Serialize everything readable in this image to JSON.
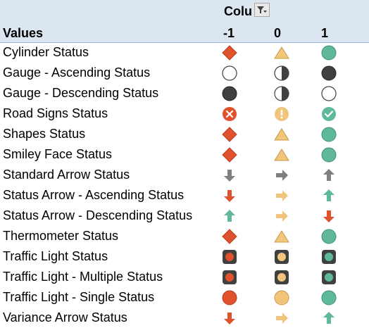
{
  "pivot": {
    "column_header": "Columns",
    "values_label": "Values",
    "columns": [
      "-1",
      "0",
      "1"
    ]
  },
  "rows": [
    {
      "name": "Cylinder Status",
      "icons": [
        "red-diamond-icon",
        "yellow-triangle-icon",
        "green-circle-icon"
      ]
    },
    {
      "name": "Gauge - Ascending Status",
      "icons": [
        "empty-circle-icon",
        "half-circle-icon",
        "full-circle-icon"
      ]
    },
    {
      "name": "Gauge - Descending Status",
      "icons": [
        "full-circle-icon",
        "half-circle-icon",
        "empty-circle-icon"
      ]
    },
    {
      "name": "Road Signs Status",
      "icons": [
        "red-x-circle-icon",
        "yellow-exclamation-circle-icon",
        "green-check-circle-icon"
      ]
    },
    {
      "name": "Shapes Status",
      "icons": [
        "red-diamond-icon",
        "yellow-triangle-icon",
        "green-circle-icon"
      ]
    },
    {
      "name": "Smiley Face Status",
      "icons": [
        "red-diamond-icon",
        "yellow-triangle-icon",
        "green-circle-icon"
      ]
    },
    {
      "name": "Standard Arrow Status",
      "icons": [
        "gray-arrow-down-icon",
        "gray-arrow-right-icon",
        "gray-arrow-up-icon"
      ]
    },
    {
      "name": "Status Arrow - Ascending Status",
      "icons": [
        "red-arrow-down-icon",
        "yellow-arrow-right-icon",
        "green-arrow-up-icon"
      ]
    },
    {
      "name": "Status Arrow - Descending Status",
      "icons": [
        "green-arrow-up-icon",
        "yellow-arrow-right-icon",
        "red-arrow-down-icon"
      ]
    },
    {
      "name": "Thermometer Status",
      "icons": [
        "red-diamond-icon",
        "yellow-triangle-icon",
        "green-circle-icon"
      ]
    },
    {
      "name": "Traffic Light Status",
      "icons": [
        "traffic-light-red-icon",
        "traffic-light-yellow-icon",
        "traffic-light-green-icon"
      ]
    },
    {
      "name": "Traffic Light - Multiple Status",
      "icons": [
        "traffic-light-red-icon",
        "traffic-light-yellow-icon",
        "traffic-light-green-icon"
      ]
    },
    {
      "name": "Traffic Light - Single Status",
      "icons": [
        "red-circle-icon",
        "yellow-circle-icon",
        "green-circle-icon"
      ]
    },
    {
      "name": "Variance Arrow Status",
      "icons": [
        "red-arrow-down-icon",
        "yellow-arrow-right-icon",
        "green-arrow-up-icon"
      ]
    }
  ],
  "colors": {
    "header_bg": "#dce6f1",
    "red": "#e0522e",
    "yellow": "#f2c57c",
    "green": "#5fb89a",
    "dark": "#404040",
    "gray_arrow": "#7f7f7f"
  }
}
